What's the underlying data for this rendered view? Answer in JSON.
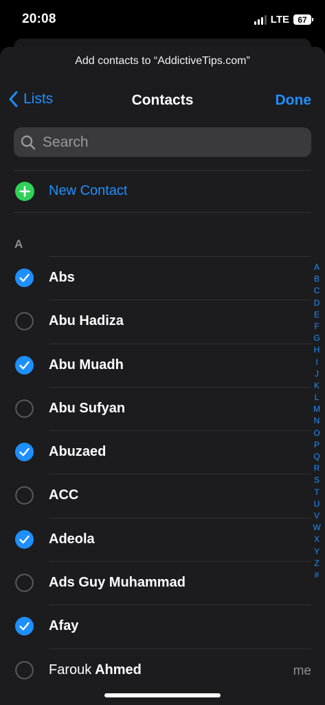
{
  "status_bar": {
    "time": "20:08",
    "network": "LTE",
    "battery": "67"
  },
  "sheet": {
    "prompt": "Add contacts to “AddictiveTips.com”"
  },
  "nav": {
    "back_label": "Lists",
    "title": "Contacts",
    "done_label": "Done"
  },
  "search": {
    "placeholder": "Search",
    "value": ""
  },
  "new_contact": {
    "label": "New Contact",
    "icon": "plus-circle-icon",
    "color": "#30d158"
  },
  "section": {
    "header": "A"
  },
  "accent_color": "#1e8fff",
  "contacts": [
    {
      "name": "Abs",
      "selected": true
    },
    {
      "name": "Abu Hadiza",
      "selected": false
    },
    {
      "name": "Abu Muadh",
      "selected": true
    },
    {
      "name": "Abu Sufyan",
      "selected": false
    },
    {
      "name": "Abuzaed",
      "selected": true
    },
    {
      "name": "ACC",
      "selected": false
    },
    {
      "name": "Adeola",
      "selected": true
    },
    {
      "name": "Ads Guy Muhammad",
      "selected": false
    },
    {
      "name": "Afay",
      "selected": true
    },
    {
      "first": "Farouk",
      "last": "Ahmed",
      "tag": "me",
      "selected": false
    }
  ],
  "index_letters": [
    "A",
    "B",
    "C",
    "D",
    "E",
    "F",
    "G",
    "H",
    "I",
    "J",
    "K",
    "L",
    "M",
    "N",
    "O",
    "P",
    "Q",
    "R",
    "S",
    "T",
    "U",
    "V",
    "W",
    "X",
    "Y",
    "Z",
    "#"
  ]
}
